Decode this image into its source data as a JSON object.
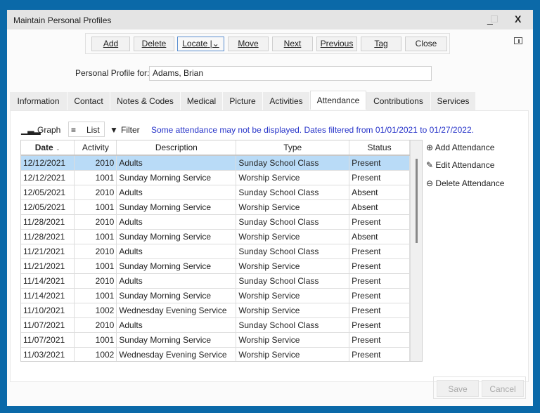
{
  "window": {
    "title": "Maintain Personal Profiles",
    "minimize": "_",
    "close": "X"
  },
  "toolbar": {
    "buttons": [
      "Add",
      "Delete",
      "Locate",
      "Move",
      "Next",
      "Previous",
      "Tag",
      "Close"
    ]
  },
  "profile": {
    "label": "Personal Profile for:",
    "value": "Adams, Brian"
  },
  "tabs": [
    "Information",
    "Contact",
    "Notes & Codes",
    "Medical",
    "Picture",
    "Activities",
    "Attendance",
    "Contributions",
    "Services"
  ],
  "active_tab": "Attendance",
  "view": {
    "graph": "Graph",
    "list": "List",
    "filter": "Filter",
    "notice": "Some attendance may not be displayed. Dates filtered from 01/01/2021 to 01/27/2022."
  },
  "table": {
    "headers": [
      "Date",
      "Activity",
      "Description",
      "Type",
      "Status"
    ],
    "rows": [
      [
        "12/12/2021",
        "2010",
        "Adults",
        "Sunday School Class",
        "Present"
      ],
      [
        "12/12/2021",
        "1001",
        "Sunday Morning Service",
        "Worship Service",
        "Present"
      ],
      [
        "12/05/2021",
        "2010",
        "Adults",
        "Sunday School Class",
        "Absent"
      ],
      [
        "12/05/2021",
        "1001",
        "Sunday Morning Service",
        "Worship Service",
        "Absent"
      ],
      [
        "11/28/2021",
        "2010",
        "Adults",
        "Sunday School Class",
        "Present"
      ],
      [
        "11/28/2021",
        "1001",
        "Sunday Morning Service",
        "Worship Service",
        "Absent"
      ],
      [
        "11/21/2021",
        "2010",
        "Adults",
        "Sunday School Class",
        "Present"
      ],
      [
        "11/21/2021",
        "1001",
        "Sunday Morning Service",
        "Worship Service",
        "Present"
      ],
      [
        "11/14/2021",
        "2010",
        "Adults",
        "Sunday School Class",
        "Present"
      ],
      [
        "11/14/2021",
        "1001",
        "Sunday Morning Service",
        "Worship Service",
        "Present"
      ],
      [
        "11/10/2021",
        "1002",
        "Wednesday Evening Service",
        "Worship Service",
        "Present"
      ],
      [
        "11/07/2021",
        "2010",
        "Adults",
        "Sunday School Class",
        "Present"
      ],
      [
        "11/07/2021",
        "1001",
        "Sunday Morning Service",
        "Worship Service",
        "Present"
      ],
      [
        "11/03/2021",
        "1002",
        "Wednesday Evening Service",
        "Worship Service",
        "Present"
      ]
    ]
  },
  "actions": {
    "add": "Add Attendance",
    "edit": "Edit Attendance",
    "delete": "Delete Attendance"
  },
  "footer": {
    "save": "Save",
    "cancel": "Cancel"
  },
  "colors": {
    "frame": "#0b69a8",
    "selected_row": "#b9dbf7",
    "notice": "#2633c9"
  }
}
